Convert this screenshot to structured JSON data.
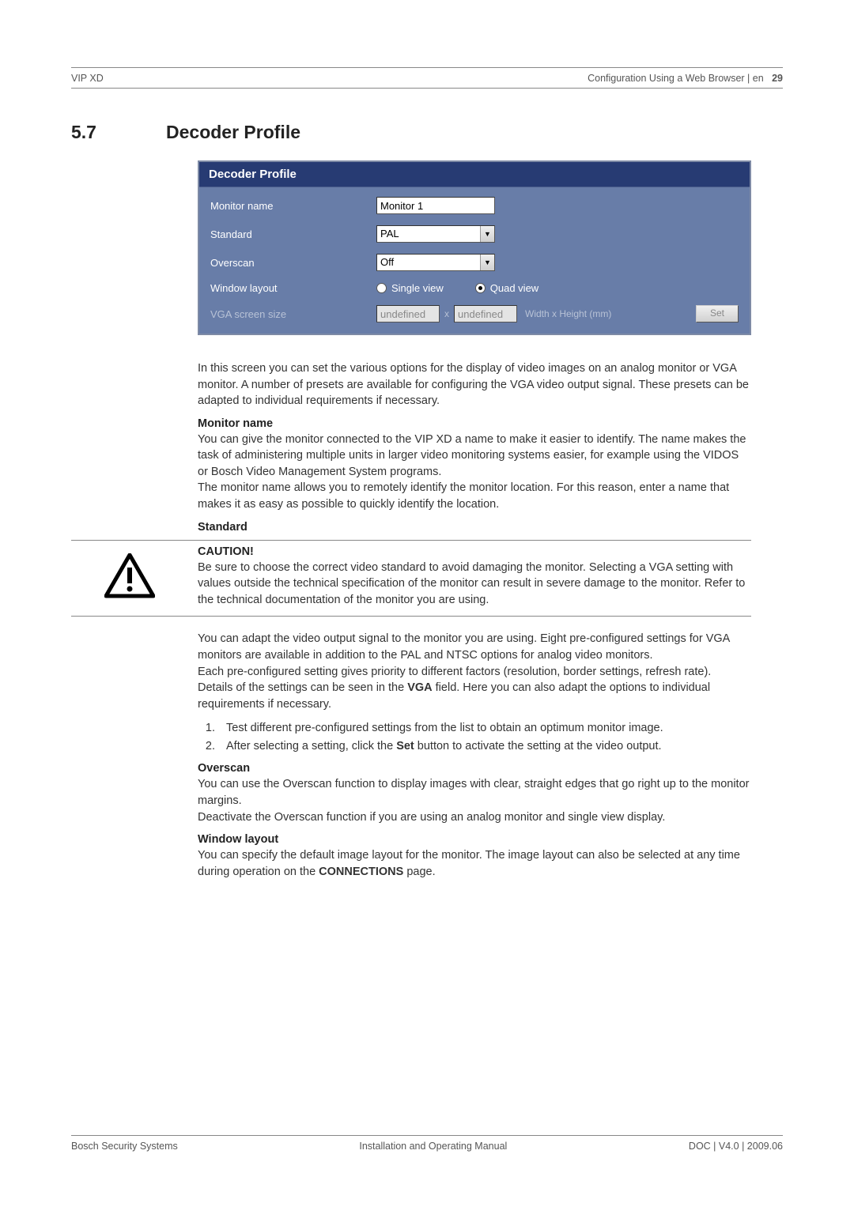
{
  "header": {
    "left": "VIP XD",
    "right_text": "Configuration Using a Web Browser | en",
    "page_num": "29"
  },
  "section": {
    "number": "5.7",
    "title": "Decoder Profile"
  },
  "panel": {
    "title": "Decoder Profile",
    "monitor_name_label": "Monitor name",
    "monitor_name_value": "Monitor 1",
    "standard_label": "Standard",
    "standard_value": "PAL",
    "overscan_label": "Overscan",
    "overscan_value": "Off",
    "window_layout_label": "Window layout",
    "single_view": "Single view",
    "quad_view": "Quad view",
    "vga_label": "VGA screen size",
    "vga_val1": "undefined",
    "vga_sep": "x",
    "vga_val2": "undefined",
    "vga_wh": "Width x Height (mm)",
    "set_button": "Set"
  },
  "body": {
    "intro": "In this screen you can set the various options for the display of video images on an analog monitor or VGA monitor. A number of presets are available for configuring the VGA video output signal. These presets can be adapted to individual requirements if necessary.",
    "monitor_head": "Monitor name",
    "monitor_p1": "You can give the monitor connected to the VIP XD a name to make it easier to identify. The name makes the task of administering multiple units in larger video monitoring systems easier, for example using the VIDOS or Bosch Video Management System programs.",
    "monitor_p2": "The monitor name allows you to remotely identify the monitor location. For this reason, enter a name that makes it as easy as possible to quickly identify the location.",
    "standard_head": "Standard",
    "caution_head": "CAUTION!",
    "caution_body": "Be sure to choose the correct video standard to avoid damaging the monitor. Selecting a VGA setting with values outside the technical specification of the monitor can result in severe damage to the monitor. Refer to the technical documentation of the monitor you are using.",
    "standard_p1": "You can adapt the video output signal to the monitor you are using. Eight pre-configured settings for VGA monitors are available in addition to the PAL and NTSC options for analog video monitors.",
    "standard_p2": "Each pre-configured setting gives priority to different factors (resolution, border settings, refresh rate).",
    "standard_p3a": "Details of the settings can be seen in the ",
    "standard_p3_vga": "VGA",
    "standard_p3b": " field. Here you can also adapt the options to individual requirements if necessary.",
    "li1": "Test different pre-configured settings from the list to obtain an optimum monitor image.",
    "li2a": "After selecting a setting, click the ",
    "li2_set": "Set",
    "li2b": " button to activate the setting at the video output.",
    "overscan_head": "Overscan",
    "overscan_p1": "You can use the Overscan function to display images with clear, straight edges that go right up to the monitor margins.",
    "overscan_p2": "Deactivate the Overscan function if you are using an analog monitor and single view display.",
    "window_head": "Window layout",
    "window_p1a": "You can specify the default image layout for the monitor. The image layout can also be selected at any time during operation on the ",
    "window_p1_conn": "CONNECTIONS",
    "window_p1b": " page."
  },
  "footer": {
    "left": "Bosch Security Systems",
    "center": "Installation and Operating Manual",
    "right": "DOC | V4.0 | 2009.06"
  }
}
